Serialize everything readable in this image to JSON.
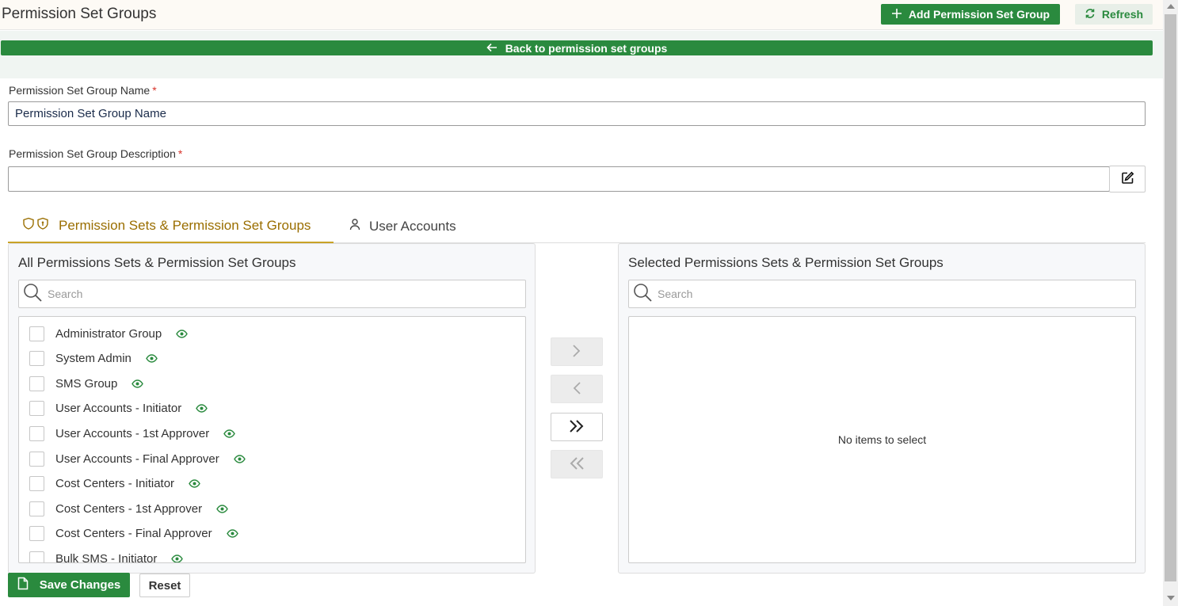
{
  "header": {
    "title": "Permission Set Groups",
    "add_label": "Add Permission Set Group",
    "refresh_label": "Refresh"
  },
  "back_label": "Back to permission set groups",
  "form": {
    "name_label": "Permission Set Group Name",
    "name_value": "Permission Set Group Name",
    "desc_label": "Permission Set Group Description",
    "desc_value": "",
    "required_marker": "*"
  },
  "tabs": [
    {
      "label": "Permission Sets & Permission Set Groups",
      "active": true,
      "icon": "shield-pair-icon"
    },
    {
      "label": "User Accounts",
      "active": false,
      "icon": "user-icon"
    }
  ],
  "left_panel": {
    "title": "All Permissions Sets & Permission Set Groups",
    "search_placeholder": "Search",
    "items": [
      "Administrator Group",
      "System Admin",
      "SMS Group",
      "User Accounts - Initiator",
      "User Accounts - 1st Approver",
      "User Accounts - Final Approver",
      "Cost Centers - Initiator",
      "Cost Centers - 1st Approver",
      "Cost Centers - Final Approver",
      "Bulk SMS - Initiator"
    ]
  },
  "right_panel": {
    "title": "Selected Permissions Sets & Permission Set Groups",
    "search_placeholder": "Search",
    "empty_message": "No items to select"
  },
  "actions": {
    "save_label": "Save Changes",
    "reset_label": "Reset"
  },
  "colors": {
    "primary_green": "#2a8a3e",
    "active_tab": "#9a6e00",
    "required": "#d9342b"
  }
}
